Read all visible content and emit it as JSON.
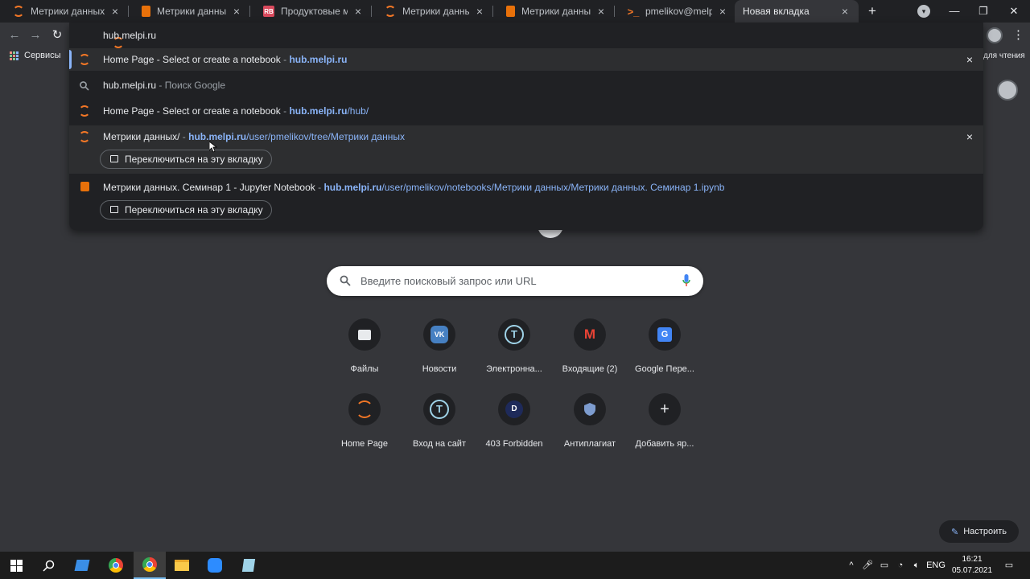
{
  "tabs": [
    {
      "title": "Метрики данных/",
      "icon": "jupyter-icon"
    },
    {
      "title": "Метрики данных. Сем",
      "icon": "notebook-icon"
    },
    {
      "title": "Продуктовые метрики",
      "icon": "rb-icon"
    },
    {
      "title": "Метрики данных/",
      "icon": "jupyter-icon"
    },
    {
      "title": "Метрики данных. Сем",
      "icon": "notebook-icon"
    },
    {
      "title": "pmelikov@melpi: ~",
      "icon": "terminal-icon"
    },
    {
      "title": "Новая вкладка",
      "icon": "",
      "active": true
    }
  ],
  "bookmarks": {
    "services_label": "Сервисы",
    "reading_list": "для чтения"
  },
  "omnibox": {
    "input_value": "hub.melpi.ru",
    "suggestions": [
      {
        "title": "Home Page - Select or create a notebook",
        "sep": " - ",
        "domain": "hub.melpi.ru",
        "path": ""
      },
      {
        "title": "hub.melpi.ru",
        "sep": " - ",
        "hint": "Поиск Google"
      },
      {
        "title": "Home Page - Select or create a notebook",
        "sep": " - ",
        "domain": "hub.melpi.ru",
        "path": "/hub/"
      },
      {
        "title": "Метрики данных/",
        "sep": " - ",
        "domain": "hub.melpi.ru",
        "path": "/user/pmelikov/tree/Метрики данных",
        "switch": "Переключиться на эту вкладку"
      },
      {
        "title": "Метрики данных. Семинар 1 - Jupyter Notebook",
        "sep": " - ",
        "domain": "hub.melpi.ru",
        "path": "/user/pmelikov/notebooks/Метрики данных/Метрики данных. Семинар 1.ipynb",
        "switch": "Переключиться на эту вкладку"
      }
    ]
  },
  "search": {
    "placeholder": "Введите поисковый запрос или URL"
  },
  "shortcuts": [
    {
      "label": "Файлы",
      "icon": "files-icon"
    },
    {
      "label": "Новости",
      "icon": "vk-icon"
    },
    {
      "label": "Электронна...",
      "icon": "t-icon"
    },
    {
      "label": "Входящие (2)",
      "icon": "gmail-icon"
    },
    {
      "label": "Google Пере...",
      "icon": "translate-icon"
    },
    {
      "label": "Home Page",
      "icon": "jupyter-icon"
    },
    {
      "label": "Вход на сайт",
      "icon": "t-icon"
    },
    {
      "label": "403 Forbidden",
      "icon": "d-icon"
    },
    {
      "label": "Антиплагиат",
      "icon": "shield-icon"
    },
    {
      "label": "Добавить яр...",
      "icon": "plus-icon"
    }
  ],
  "shortcut_glyphs": {
    "d": "D",
    "plus": "+",
    "t": "T",
    "vk": "VK",
    "gmail": "M"
  },
  "customize_label": "Настроить",
  "taskbar": {
    "lang": "ENG",
    "time": "16:21",
    "date": "05.07.2021"
  },
  "colors": {
    "accent": "#8ab4f8",
    "jupyter": "#f37726",
    "bg": "#35363a"
  }
}
